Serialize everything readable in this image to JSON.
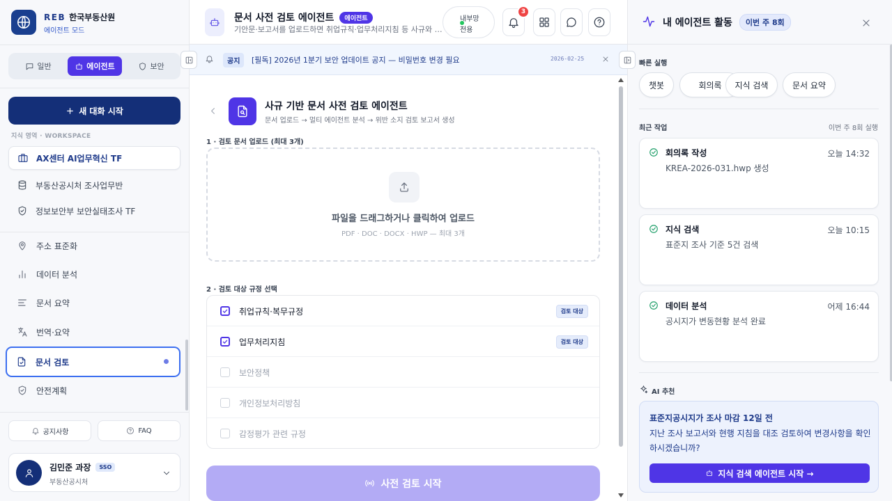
{
  "brand": {
    "logo_text": "REB",
    "org": "한국부동산원",
    "mode": "에이전트 모드"
  },
  "mode_tabs": [
    {
      "label": "일반",
      "icon": "chat-icon",
      "active": false
    },
    {
      "label": "에이전트",
      "icon": "robot-icon",
      "active": true
    },
    {
      "label": "보안",
      "icon": "shield-icon",
      "active": false
    }
  ],
  "new_chat": {
    "label": "새 대화 시작"
  },
  "workspace": {
    "caption": "지식 영역 · WORKSPACE",
    "items": [
      {
        "label": "AX센터 AI업무혁신 TF",
        "icon": "briefcase-icon",
        "active": true
      },
      {
        "label": "부동산공시처 조사업무반",
        "icon": "database-icon",
        "active": false
      },
      {
        "label": "정보보안부 보안실태조사 TF",
        "icon": "shield-check-icon",
        "active": false
      }
    ]
  },
  "nav": [
    {
      "label": "주소 표준화",
      "icon": "location-pin-icon",
      "active": false
    },
    {
      "label": "데이터 분석",
      "icon": "bar-chart-icon",
      "active": false
    },
    {
      "label": "문서 요약",
      "icon": "text-lines-icon",
      "active": false
    },
    {
      "label": "번역·요약",
      "icon": "translate-icon",
      "active": false
    },
    {
      "label": "문서 검토",
      "icon": "file-check-icon",
      "active": true
    },
    {
      "label": "안전계획",
      "icon": "shield-check-icon",
      "active": false
    }
  ],
  "footer": {
    "notice_label": "공지사항",
    "faq_label": "FAQ"
  },
  "user": {
    "name": "김민준 과장",
    "badge": "SSO",
    "org": "부동산공시처"
  },
  "header": {
    "title": "문서 사전 검토 에이전트",
    "badge": "에이전트",
    "description": "기안문·보고서를 업로드하면 취업규칙·업무처리지침 등 사규와 대조하여 위반 소지를 검토합니다",
    "internal_line1": "내부망",
    "internal_line2": "전용",
    "notification_count": "3",
    "status_color": "#22c55e"
  },
  "notice": {
    "tag": "공지",
    "text": "[필독] 2026년 1분기 보안 업데이트 공지 — 비밀번호 변경 필요",
    "date": "2026-02-25"
  },
  "page": {
    "title": "사규 기반 문서 사전 검토 에이전트",
    "subtitle": "문서 업로드 → 멀티 에이전트 분석 → 위반 소지 검토 보고서 생성",
    "step1": "1 · 검토 문서 업로드 (최대 3개)",
    "upload_title": "파일을 드래그하거나 클릭하여 업로드",
    "upload_hint": "PDF · DOC · DOCX · HWP — 최대 3개",
    "step2": "2 · 검토 대상 규정 선택",
    "rules": [
      {
        "label": "취업규칙·복무규정",
        "checked": true,
        "tag": "검토 대상"
      },
      {
        "label": "업무처리지침",
        "checked": true,
        "tag": "검토 대상"
      },
      {
        "label": "보안정책",
        "checked": false,
        "tag": ""
      },
      {
        "label": "개인정보처리방침",
        "checked": false,
        "tag": ""
      },
      {
        "label": "감정평가 관련 규정",
        "checked": false,
        "tag": ""
      }
    ],
    "start_label": "사전 검토 시작"
  },
  "panel": {
    "title": "내 에이전트 활동",
    "week_badge": "이번 주 8회",
    "quick_caption": "빠른 실행",
    "quick": [
      "챗봇",
      "회의록",
      "지식 검색",
      "문서 요약"
    ],
    "recent_caption": "최근 작업",
    "recent_meta": "이번 주 8회 실행",
    "activities": [
      {
        "title": "회의록 작성",
        "time": "오늘 14:32",
        "desc": "KREA-2026-031.hwp 생성"
      },
      {
        "title": "지식 검색",
        "time": "오늘 10:15",
        "desc": "표준지 조사 기준 5건 검색"
      },
      {
        "title": "데이터 분석",
        "time": "어제 16:44",
        "desc": "공시지가 변동현황 분석 완료"
      }
    ],
    "ai_caption": "AI 추천",
    "rec_title": "표준지공시지가 조사 마감 12일 전",
    "rec_desc": "지난 조사 보고서와 현행 지침을 대조 검토하여 변경사항을 확인하시겠습니까?",
    "rec_button": "지식 검색 에이전트 시작 →"
  },
  "colors": {
    "primary": "#4f35e6",
    "navy": "#142f78",
    "success": "#22a06b",
    "alert": "#ef4444"
  }
}
